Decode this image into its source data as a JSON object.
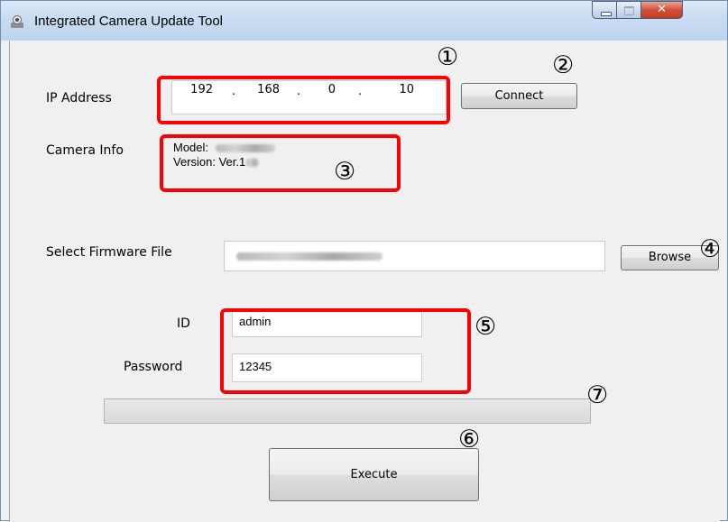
{
  "window": {
    "title": "Integrated Camera Update Tool",
    "icon": "camera-app-icon"
  },
  "ip": {
    "label": "IP Address",
    "octets": [
      "192",
      "168",
      "0",
      "10"
    ],
    "connect_label": "Connect"
  },
  "camera_info": {
    "label": "Camera Info",
    "model_label": "Model:",
    "version_label": "Version: Ver.1"
  },
  "firmware": {
    "label": "Select Firmware File",
    "browse_label": "Browse"
  },
  "credentials": {
    "id_label": "ID",
    "id_value": "admin",
    "password_label": "Password",
    "password_value": "12345"
  },
  "progress": {
    "fraction": 0
  },
  "execute_label": "Execute",
  "annotations": {
    "m1": "①",
    "m2": "②",
    "m3": "③",
    "m4": "④",
    "m5": "⑤",
    "m6": "⑥",
    "m7": "⑦"
  },
  "colors": {
    "highlight": "#ff0000",
    "titlebar": "#c9dcf1",
    "close_button": "#c13a22"
  }
}
